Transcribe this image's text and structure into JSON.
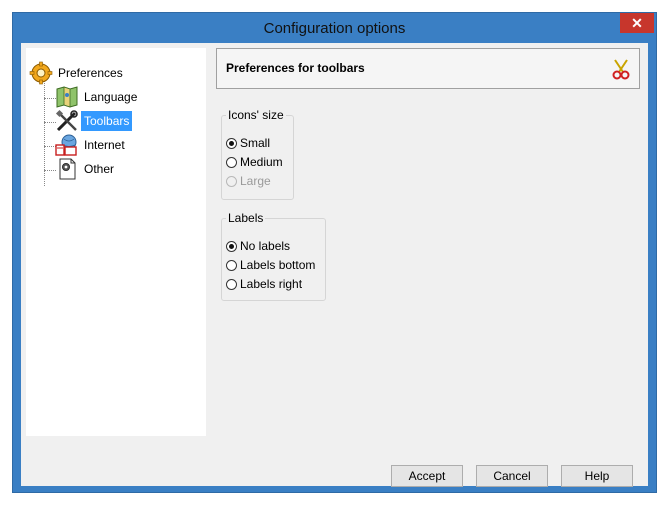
{
  "window": {
    "title": "Configuration options",
    "close_symbol": "✕"
  },
  "tree": {
    "root": {
      "label": "Preferences",
      "icon": "gear-icon"
    },
    "items": [
      {
        "label": "Language",
        "icon": "map-icon"
      },
      {
        "label": "Toolbars",
        "icon": "tools-icon",
        "selected": true
      },
      {
        "label": "Internet",
        "icon": "internet-icon"
      },
      {
        "label": "Other",
        "icon": "document-gear-icon"
      }
    ]
  },
  "panel": {
    "title": "Preferences for toolbars",
    "icon": "scissors-icon",
    "icons_size": {
      "legend": "Icons' size",
      "options": [
        {
          "label": "Small",
          "checked": true,
          "disabled": false
        },
        {
          "label": "Medium",
          "checked": false,
          "disabled": false
        },
        {
          "label": "Large",
          "checked": false,
          "disabled": true
        }
      ]
    },
    "labels": {
      "legend": "Labels",
      "options": [
        {
          "label": "No labels",
          "checked": true
        },
        {
          "label": "Labels bottom",
          "checked": false
        },
        {
          "label": "Labels right",
          "checked": false
        }
      ]
    }
  },
  "buttons": {
    "accept": "Accept",
    "cancel": "Cancel",
    "help": "Help"
  },
  "colors": {
    "frame": "#3a7fc4",
    "selection": "#3399ff",
    "close": "#c7362c"
  }
}
